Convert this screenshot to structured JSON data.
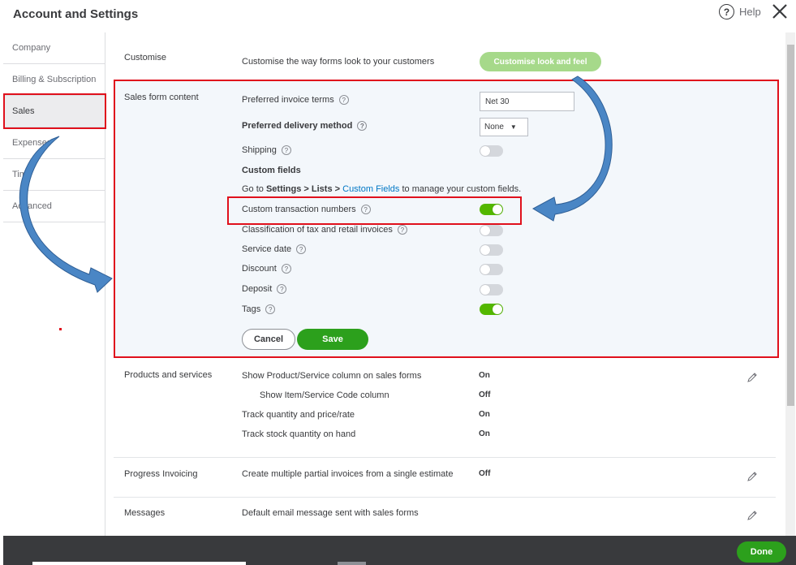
{
  "header": {
    "title": "Account and Settings",
    "help_label": "Help",
    "help_glyph": "?",
    "close_icon": "close-icon"
  },
  "sidebar": {
    "items": [
      {
        "label": "Company"
      },
      {
        "label": "Billing & Subscription"
      },
      {
        "label": "Sales",
        "active": true
      },
      {
        "label": "Expenses"
      },
      {
        "label": "Time"
      },
      {
        "label": "Advanced"
      }
    ]
  },
  "customise": {
    "section": "Customise",
    "description": "Customise the way forms look to your customers",
    "button": "Customise look and feel"
  },
  "sales_form": {
    "section": "Sales form content",
    "preferred_invoice_terms": {
      "label": "Preferred invoice terms",
      "value": "Net 30"
    },
    "preferred_delivery_method": {
      "label": "Preferred delivery method",
      "value": "None"
    },
    "shipping": {
      "label": "Shipping",
      "on": false
    },
    "custom_fields_heading": "Custom fields",
    "custom_fields_text": {
      "prefix": "Go to ",
      "bold": "Settings > Lists >",
      "link": "Custom Fields",
      "suffix": " to manage your custom fields."
    },
    "custom_transaction_numbers": {
      "label": "Custom transaction numbers",
      "on": true
    },
    "classification": {
      "label": "Classification of tax and retail invoices",
      "on": false
    },
    "service_date": {
      "label": "Service date",
      "on": false
    },
    "discount": {
      "label": "Discount",
      "on": false
    },
    "deposit": {
      "label": "Deposit",
      "on": false
    },
    "tags": {
      "label": "Tags",
      "on": true
    },
    "cancel": "Cancel",
    "save": "Save"
  },
  "products": {
    "section": "Products and services",
    "rows": [
      {
        "label": "Show Product/Service column on sales forms",
        "value": "On"
      },
      {
        "label": "Show Item/Service Code column",
        "value": "Off"
      },
      {
        "label": "Track quantity and price/rate",
        "value": "On"
      },
      {
        "label": "Track stock quantity on hand",
        "value": "On"
      }
    ]
  },
  "progress_invoicing": {
    "section": "Progress Invoicing",
    "description": "Create multiple partial invoices from a single estimate",
    "value": "Off"
  },
  "messages": {
    "section": "Messages",
    "description": "Default email message sent with sales forms"
  },
  "footer": {
    "done": "Done"
  },
  "colors": {
    "accent_green": "#2ca01c",
    "toggle_on": "#53b700",
    "highlight_red": "#e0101c",
    "arrow_blue": "#4a86c5",
    "link_blue": "#0077c5"
  }
}
